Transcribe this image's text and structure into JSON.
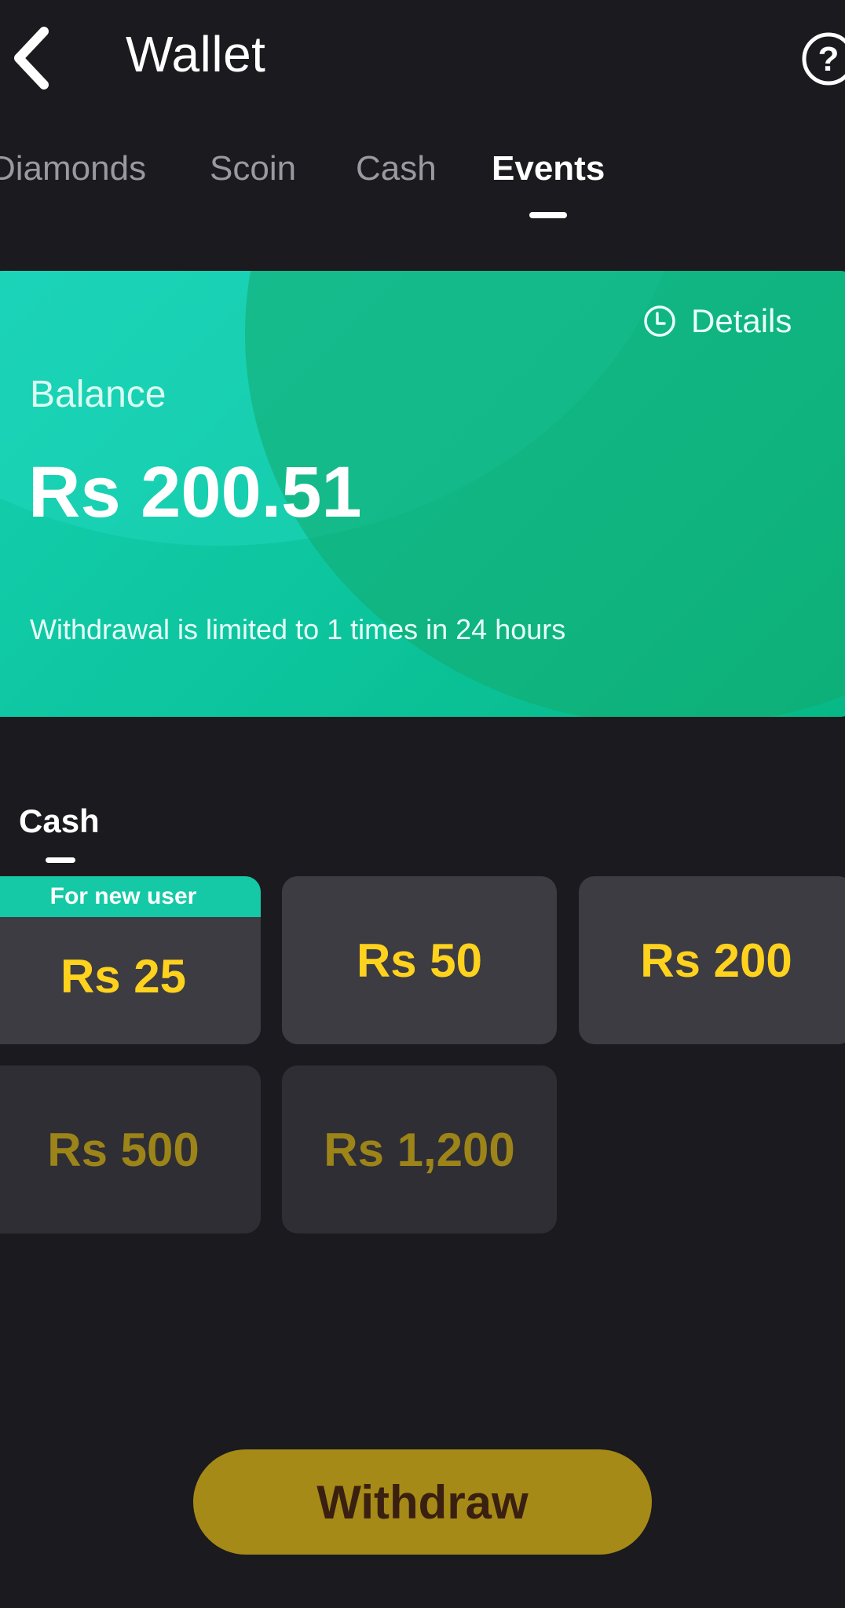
{
  "header": {
    "title": "Wallet",
    "back_icon": "chevron-left-icon",
    "help_icon": "question-circle-icon"
  },
  "tabs": [
    {
      "label": "Diamonds",
      "active": false
    },
    {
      "label": "Scoin",
      "active": false
    },
    {
      "label": "Cash",
      "active": false
    },
    {
      "label": "Events",
      "active": true
    }
  ],
  "balance_card": {
    "details_label": "Details",
    "details_icon": "clock-icon",
    "balance_label": "Balance",
    "balance_amount": "Rs 200.51",
    "limit_note": "Withdrawal is limited to 1 times in 24 hours"
  },
  "cash_section": {
    "title": "Cash",
    "options": [
      {
        "amount": "Rs 25",
        "badge": "For new user",
        "enabled": true
      },
      {
        "amount": "Rs 50",
        "enabled": true
      },
      {
        "amount": "Rs 200",
        "enabled": true
      },
      {
        "amount": "Rs 500",
        "enabled": false
      },
      {
        "amount": "Rs 1,200",
        "enabled": false
      }
    ]
  },
  "withdraw_button": {
    "label": "Withdraw"
  },
  "colors": {
    "background": "#1b1a1f",
    "card_gradient_start": "#15cfb0",
    "card_gradient_end": "#06b885",
    "amount_yellow": "#ffd21e",
    "amount_disabled": "#9c8419",
    "badge_teal": "#15c9a6",
    "withdraw_button": "#a68a17"
  }
}
